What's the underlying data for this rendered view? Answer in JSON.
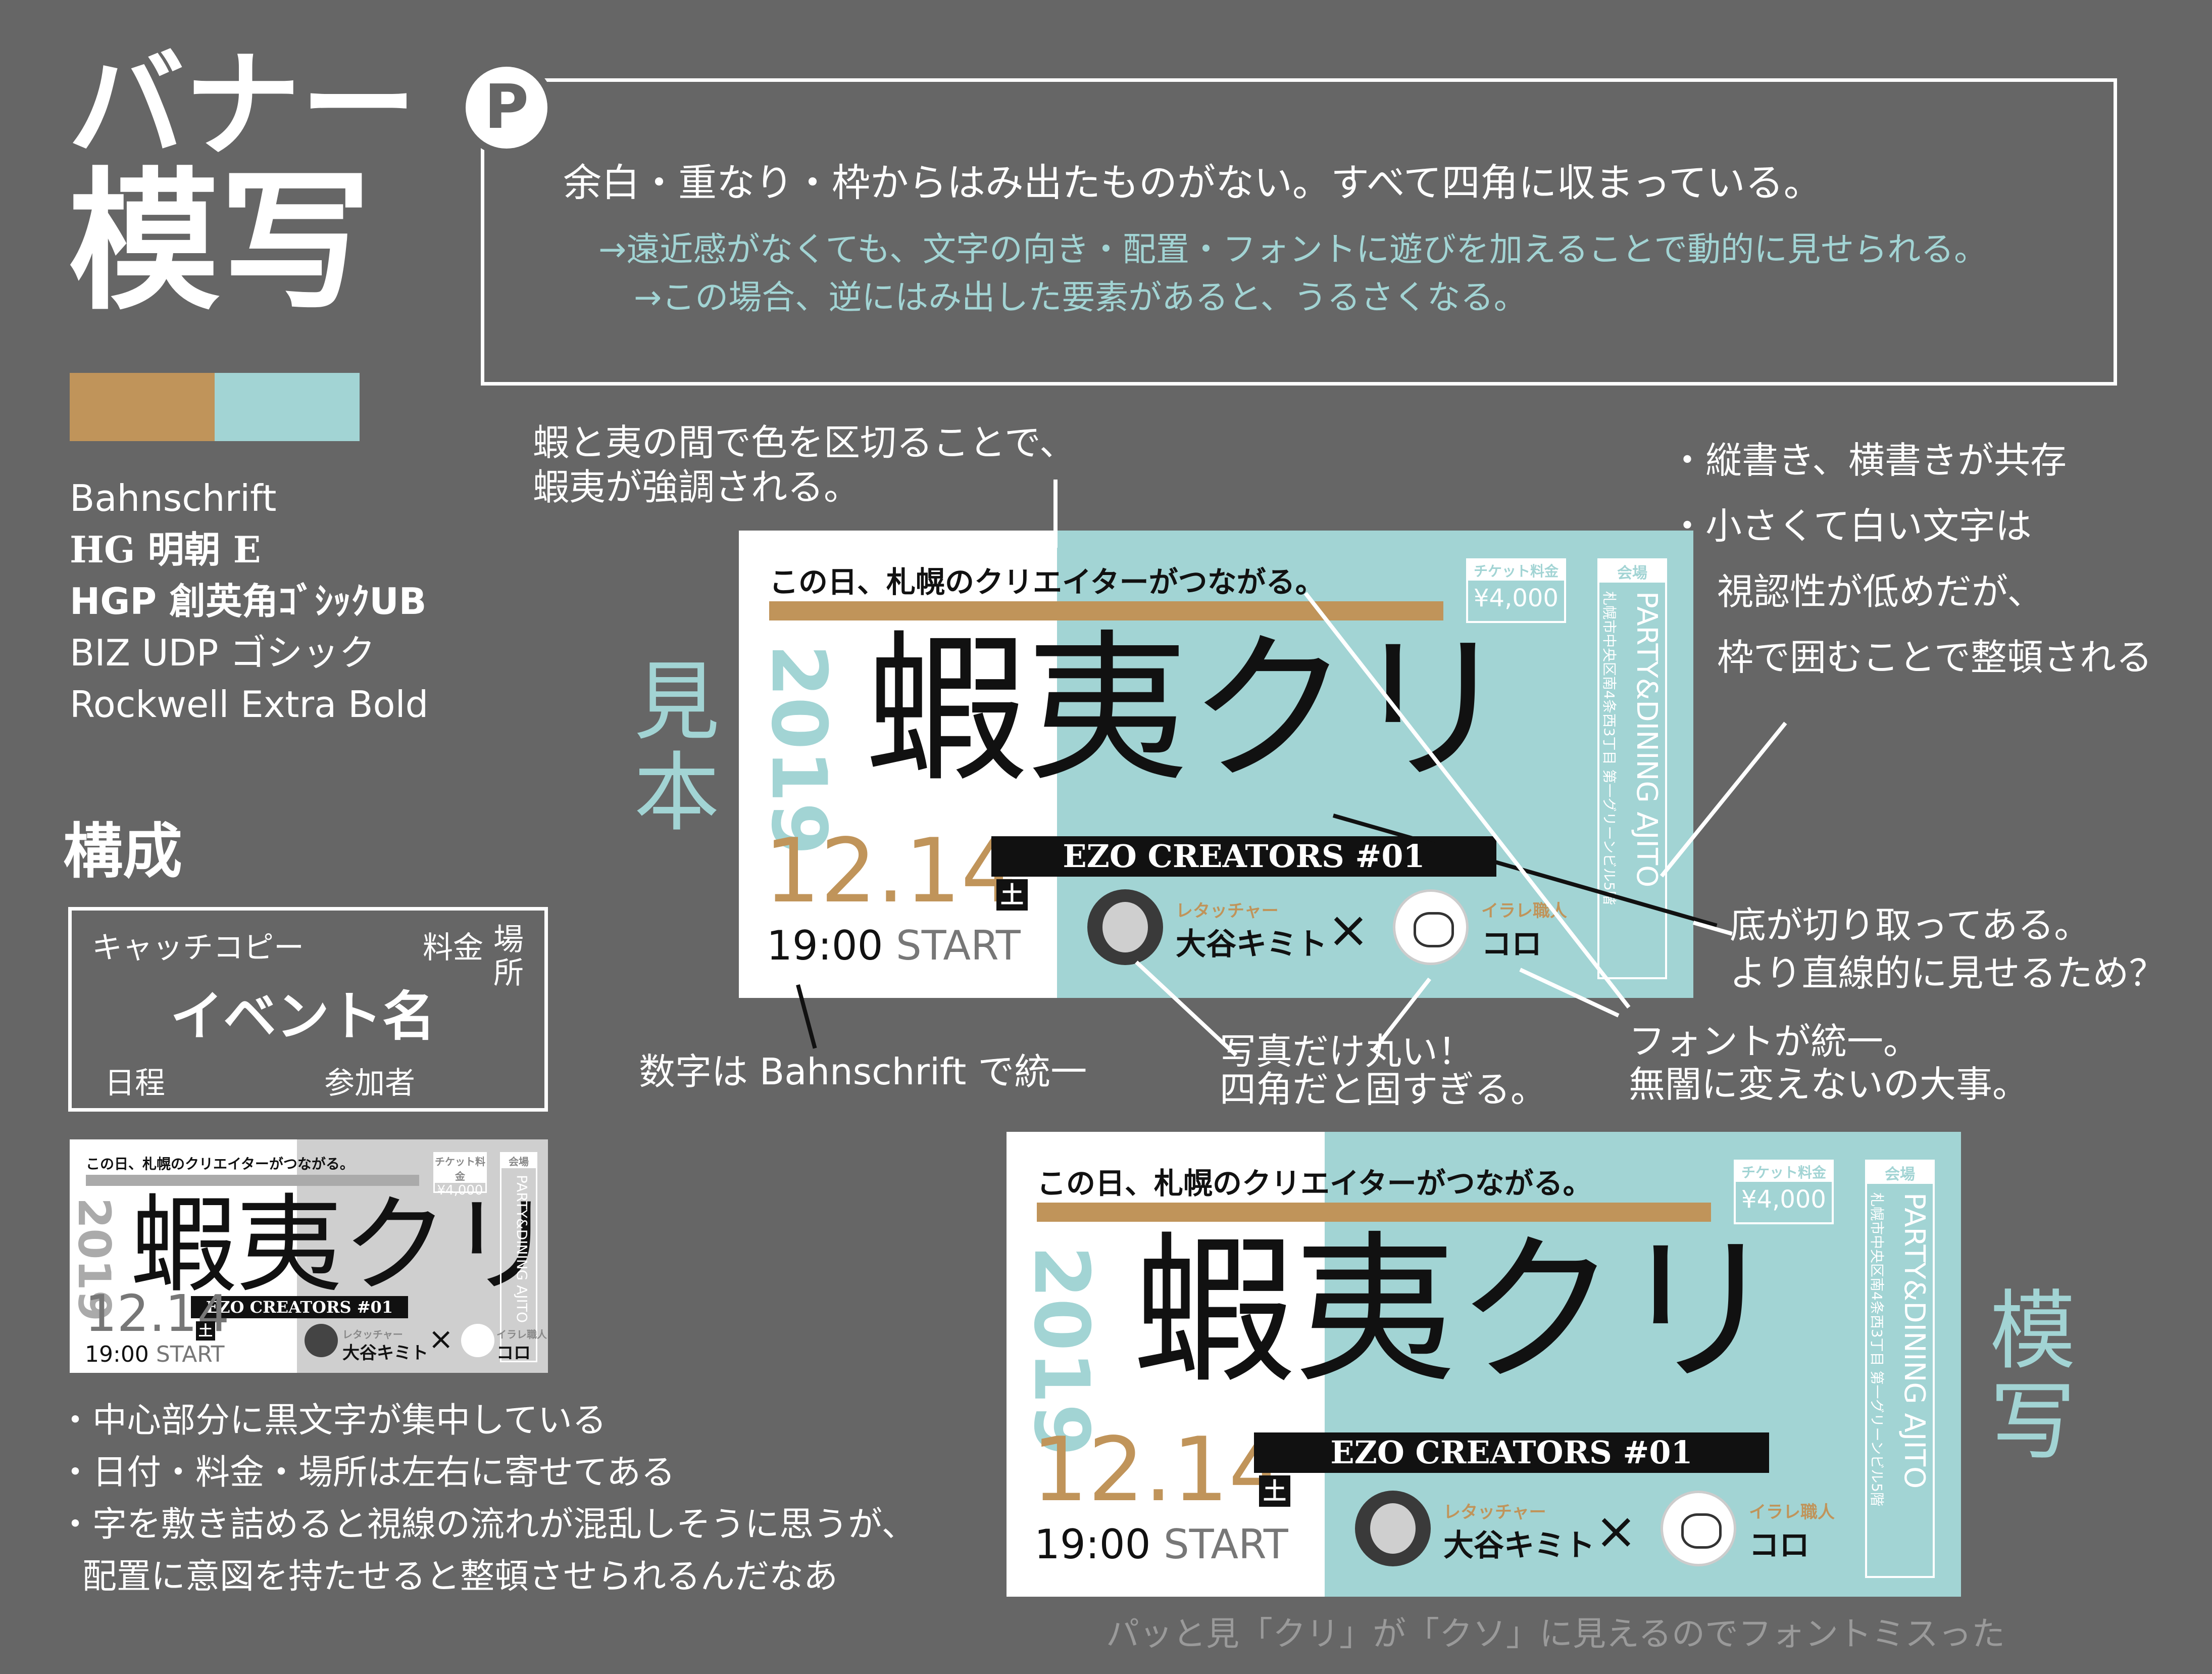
{
  "header": {
    "title_line1": "バナー",
    "title_line2": "模写"
  },
  "colors": {
    "gold": "#c0945a",
    "teal": "#a2d4d4",
    "background": "#666666"
  },
  "fonts": [
    "Bahnschrift",
    "HG 明朝 E",
    "HGP 創英角ｺﾞｼｯｸUB",
    "BIZ UDP ゴシック",
    "Rockwell Extra Bold"
  ],
  "point": {
    "badge": "P",
    "main": "余白・重なり・枠からはみ出たものがない。すべて四角に収まっている。",
    "sub1": "→遠近感がなくても、文字の向き・配置・フォントに遊びを加えることで動的に見せられる。",
    "sub2": "→この場合、逆にはみ出した要素があると、うるさくなる。"
  },
  "structure": {
    "heading": "構成",
    "catch": "キャッチコピー",
    "price": "料金",
    "place": "場所",
    "event": "イベント名",
    "schedule": "日程",
    "participants": "参加者"
  },
  "labels": {
    "sample": "見本",
    "copy": "模写"
  },
  "banner": {
    "catch": "この日、札幌のクリエイターがつながる。",
    "year": "2019",
    "title": "蝦夷クリ",
    "date": "12.14",
    "dow": "土",
    "time": "19:00",
    "start": "START",
    "subtitle": "EZO CREATORS #01",
    "price_label": "チケット料金",
    "price": "¥4,000",
    "venue_label": "会場",
    "venue": "PARTY&DINING AJITO",
    "address": "札幌市中央区南4条西3丁目 第一グリーンビル5階",
    "person1_role": "レタッチャー",
    "person1_name": "大谷キミト",
    "cross": "×",
    "person2_role": "イラレ職人",
    "person2_name": "コロ"
  },
  "annotations": {
    "color_split_1": "蝦と夷の間で色を区切ることで、",
    "color_split_2": "蝦夷が強調される。",
    "vertical_1": "・縦書き、横書きが共存",
    "vertical_2": "・小さくて白い文字は",
    "vertical_3": "視認性が低めだが、",
    "vertical_4": "枠で囲むことで整頓される",
    "cut_1": "底が切り取ってある。",
    "cut_2": "より直線的に見せるため？",
    "numbers": "数字は Bahnschrift で統一",
    "photo_1": "写真だけ丸い！",
    "photo_2": "四角だと固すぎる。",
    "font_1": "フォントが統一。",
    "font_2": "無闇に変えないの大事。",
    "bullet_1": "・中心部分に黒文字が集中している",
    "bullet_2": "・日付・料金・場所は左右に寄せてある",
    "bullet_3": "・字を敷き詰めると視線の流れが混乱しそうに思うが、",
    "bullet_4": "配置に意図を持たせると整頓させられるんだなあ",
    "footer": "パッと見「クリ」が「クソ」に見えるのでフォントミスった"
  }
}
